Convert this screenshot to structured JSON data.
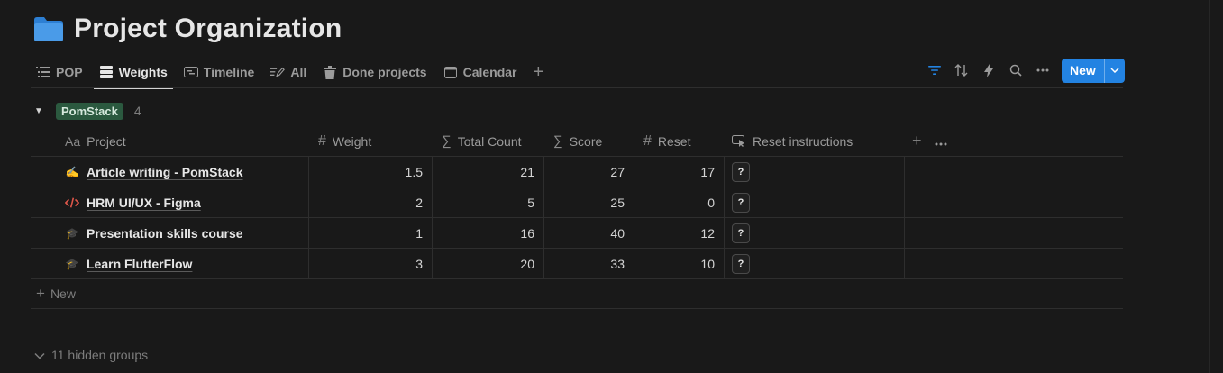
{
  "page": {
    "title": "Project Organization",
    "icon": "folder-icon"
  },
  "tabs": [
    {
      "label": "POP",
      "icon": "list-icon"
    },
    {
      "label": "Weights",
      "icon": "table-icon",
      "active": true
    },
    {
      "label": "Timeline",
      "icon": "timeline-icon"
    },
    {
      "label": "All",
      "icon": "edit-list-icon"
    },
    {
      "label": "Done projects",
      "icon": "trash-icon"
    },
    {
      "label": "Calendar",
      "icon": "calendar-icon"
    }
  ],
  "toolbar": {
    "new_label": "New",
    "accent": "#2383e2"
  },
  "group": {
    "name": "PomStack",
    "count": "4",
    "color": "#2b593f"
  },
  "columns": {
    "project": "Project",
    "weight": "Weight",
    "total_count": "Total Count",
    "score": "Score",
    "reset": "Reset",
    "reset_instructions": "Reset instructions"
  },
  "rows": [
    {
      "icon": "writing-hand-icon",
      "project": "Article writing - PomStack",
      "weight": "1.5",
      "total_count": "21",
      "score": "27",
      "reset": "17",
      "instructions": "?"
    },
    {
      "icon": "code-icon",
      "project": "HRM UI/UX - Figma",
      "weight": "2",
      "total_count": "5",
      "score": "25",
      "reset": "0",
      "instructions": "?"
    },
    {
      "icon": "graduation-cap-icon",
      "project": "Presentation skills course",
      "weight": "1",
      "total_count": "16",
      "score": "40",
      "reset": "12",
      "instructions": "?"
    },
    {
      "icon": "graduation-cap-icon",
      "project": "Learn FlutterFlow",
      "weight": "3",
      "total_count": "20",
      "score": "33",
      "reset": "10",
      "instructions": "?"
    }
  ],
  "table": {
    "new_row_label": "New"
  },
  "hidden_groups": {
    "label": "11 hidden groups"
  }
}
